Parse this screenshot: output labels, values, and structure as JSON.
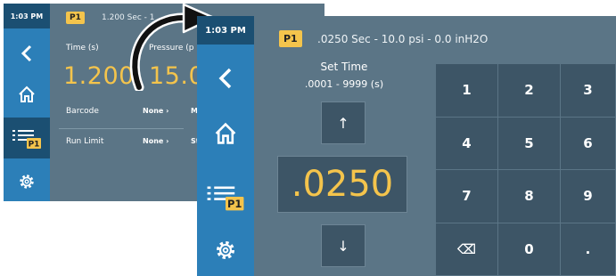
{
  "back_screen": {
    "status_time": "1:03 PM",
    "profile_badge": "P1",
    "header": "1.200 Sec - 1",
    "time_label": "Time (s)",
    "time_value": "1.200",
    "pressure_label": "Pressure (p",
    "pressure_value": "15.0",
    "barcode_label": "Barcode",
    "barcode_value": "None ›",
    "barcode_extra": "M",
    "run_limit_label": "Run Limit",
    "run_limit_value": "None ›",
    "run_limit_extra": "St",
    "sidebar_badge": "P1"
  },
  "front_screen": {
    "status_time": "1:03 PM",
    "profile_badge": "P1",
    "header": ".0250 Sec - 10.0 psi - 0.0 inH2O",
    "set_title": "Set Time",
    "set_range": ".0001 - 9999 (s)",
    "up_arrow": "↑",
    "down_arrow": "↓",
    "current_value": ".0250",
    "sidebar_badge": "P1",
    "keypad": [
      "1",
      "2",
      "3",
      "4",
      "5",
      "6",
      "7",
      "8",
      "9",
      "⌫",
      "0",
      "."
    ]
  },
  "icons": [
    "back-chevron-icon",
    "home-icon",
    "program-list-icon",
    "gear-icon",
    "curved-arrow-icon",
    "backspace-icon"
  ],
  "colors": {
    "sidebar": "#2c7fb8",
    "status_bar": "#1b4f72",
    "background": "#5b7586",
    "accent": "#f4c44c",
    "key": "#3d5566"
  }
}
